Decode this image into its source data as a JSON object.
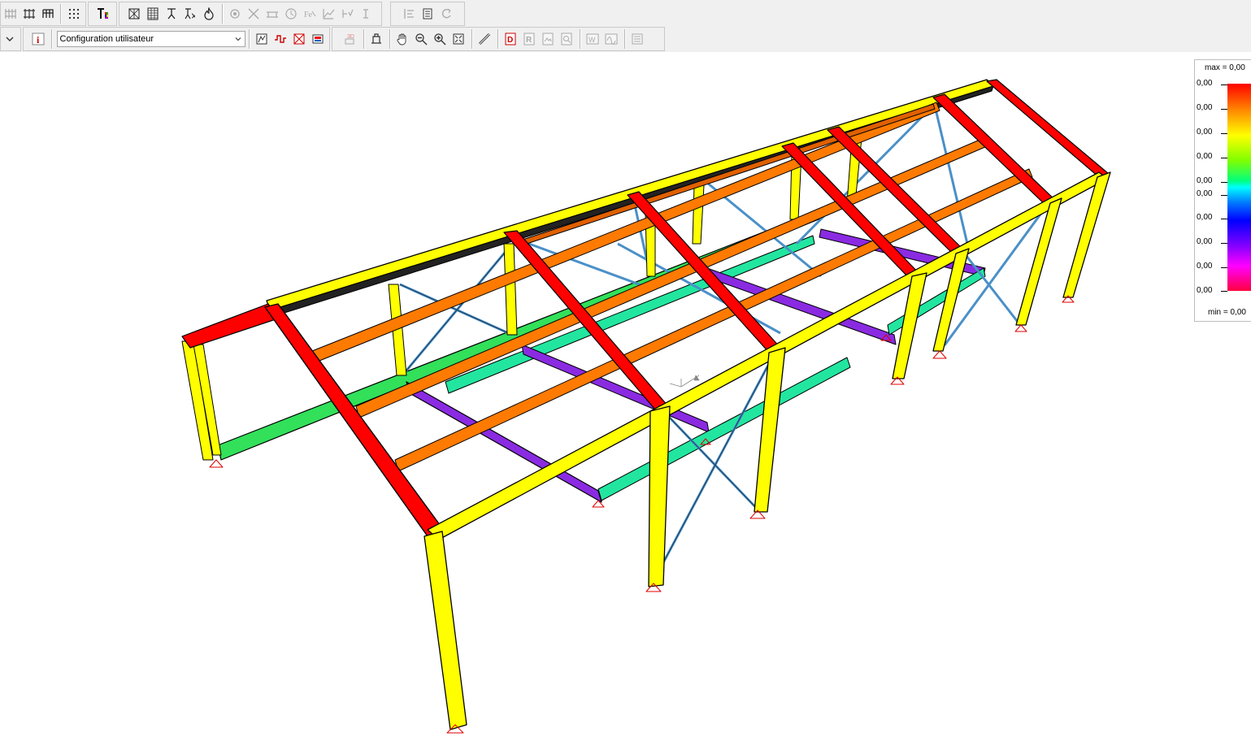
{
  "toolbar": {
    "row1_icons": [
      "grid-frame-icon",
      "grid-columns-icon",
      "grid-table-icon",
      "dots-grid-icon",
      "color-text-icon",
      "section-view-icon",
      "table-icon",
      "support-icon",
      "support-load-icon",
      "fire-icon",
      "node-settings-icon",
      "cross-icon",
      "beam-icon",
      "clock-icon",
      "formula-icon",
      "graph-icon",
      "check-icon",
      "bracket-icon",
      "align-icon",
      "report-icon",
      "refresh-icon"
    ],
    "row2_icons": [
      "info-icon",
      "display-options-icon",
      "wave-icon",
      "cross-section-icon",
      "frame-icon",
      "3d-render-icon",
      "view-orientation-icon",
      "pan-hand-icon",
      "zoom-out-icon",
      "zoom-in-icon",
      "zoom-extent-icon",
      "measure-icon",
      "doc-d-icon",
      "doc-r-icon",
      "doc-image-icon",
      "doc-search-icon",
      "w-window-icon",
      "wave-window-icon",
      "layers-icon"
    ],
    "configuration": {
      "value": "Configuration utilisateur"
    }
  },
  "legend": {
    "max_label": "max = 0,00",
    "min_label": "min = 0,00",
    "ticks": [
      "0,00",
      "0,00",
      "0,00",
      "0,00",
      "0,00",
      "0,00",
      "0,00",
      "0,00",
      "0,00",
      "0,00"
    ]
  },
  "colors": {
    "columns": "#ffff00",
    "rafters": "#ff0000",
    "purlins": "#ff7a00",
    "purple_beams": "#8a2be2",
    "green_beams": "#32e05a",
    "teal_beams": "#22e6a0",
    "bracing": "#4a90c8"
  }
}
